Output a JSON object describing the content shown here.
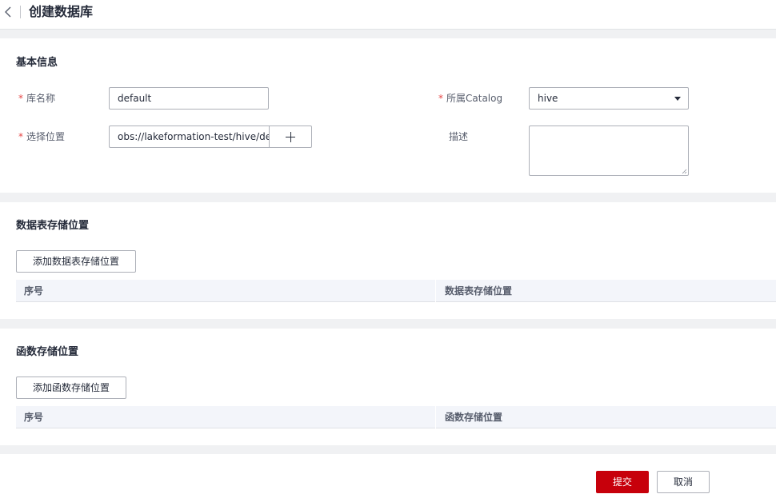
{
  "header": {
    "title": "创建数据库",
    "back_icon": "chevron-left-icon"
  },
  "basic_info": {
    "section_title": "基本信息",
    "required_mark": "*",
    "db_name": {
      "label": "库名称",
      "value": "default"
    },
    "catalog": {
      "label": "所属Catalog",
      "value": "hive"
    },
    "location": {
      "label": "选择位置",
      "value": "obs://lakeformation-test/hive/defau"
    },
    "description": {
      "label": "描述",
      "value": ""
    }
  },
  "table_storage": {
    "section_title": "数据表存储位置",
    "add_button": "添加数据表存储位置",
    "columns": [
      "序号",
      "数据表存储位置"
    ]
  },
  "function_storage": {
    "section_title": "函数存储位置",
    "add_button": "添加函数存储位置",
    "columns": [
      "序号",
      "函数存储位置"
    ]
  },
  "footer": {
    "submit": "提交",
    "cancel": "取消"
  },
  "colors": {
    "primary": "#c7000b",
    "required": "#e54545",
    "table_head": "#f3f5fa"
  }
}
